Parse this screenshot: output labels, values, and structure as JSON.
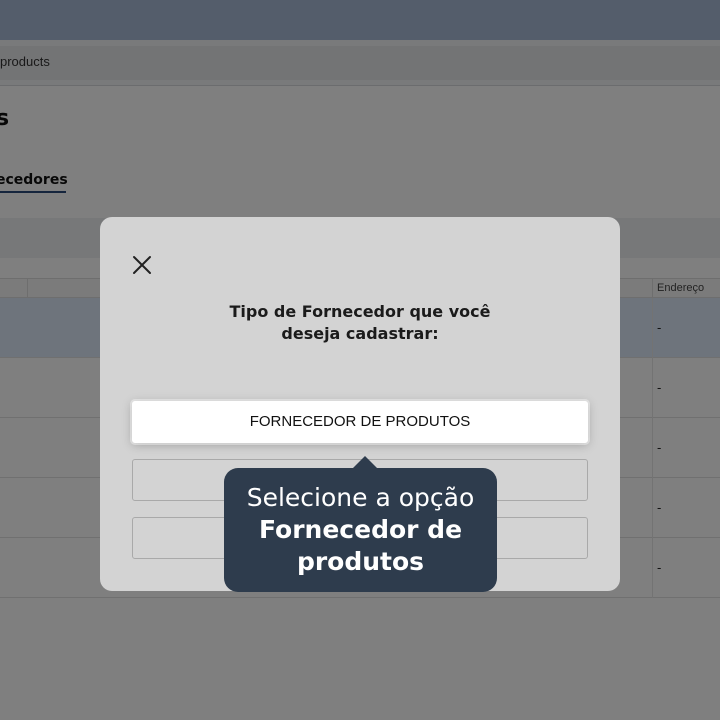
{
  "browser": {
    "address_text": "products"
  },
  "page": {
    "title": "s",
    "tab_label": "ecedores",
    "table": {
      "address_header": "Endereço",
      "rows": [
        {
          "address": "-"
        },
        {
          "address": "-"
        },
        {
          "address": "-"
        },
        {
          "address": "-"
        },
        {
          "address": "-"
        }
      ]
    }
  },
  "modal": {
    "title_line1": "Tipo de Fornecedor que você",
    "title_line2": "deseja cadastrar:",
    "options": [
      {
        "label": "FORNECEDOR DE PRODUTOS"
      },
      {
        "label": ""
      },
      {
        "label": ""
      }
    ]
  },
  "tooltip": {
    "line1": "Selecione a opção",
    "line2": "Fornecedor de",
    "line3": "produtos"
  },
  "colors": {
    "overlay": "#000000",
    "tooltip_bg": "#2e3c4d",
    "modal_bg": "#d3d3d3",
    "accent": "#2a4a7a"
  }
}
